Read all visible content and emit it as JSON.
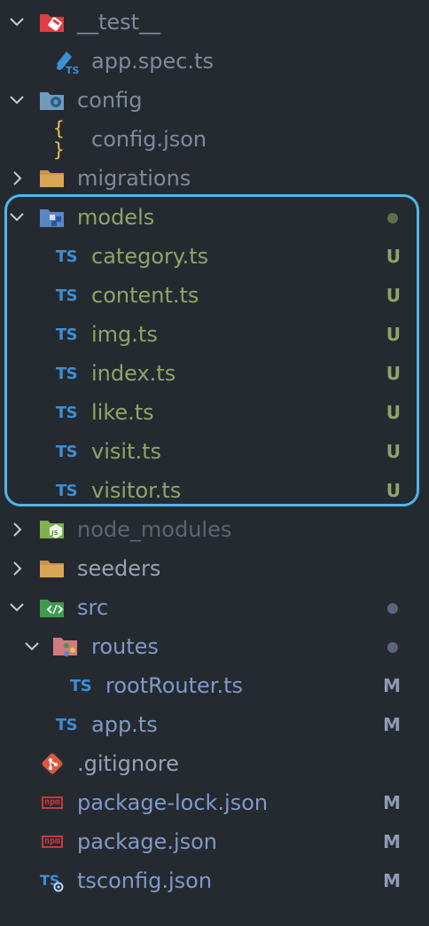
{
  "explorer": {
    "items": [
      {
        "label": "__test__",
        "icon": "test-folder-icon",
        "expanded": true
      },
      {
        "label": "app.spec.ts",
        "icon": "test-ts-file-icon"
      },
      {
        "label": "config",
        "icon": "config-folder-icon",
        "expanded": true
      },
      {
        "label": "config.json",
        "icon": "json-file-icon"
      },
      {
        "label": "migrations",
        "icon": "folder-icon",
        "expanded": false
      },
      {
        "label": "models",
        "icon": "models-folder-icon",
        "expanded": true,
        "status": "modified-dot"
      },
      {
        "label": "category.ts",
        "icon": "ts-file-icon",
        "badge": "U"
      },
      {
        "label": "content.ts",
        "icon": "ts-file-icon",
        "badge": "U"
      },
      {
        "label": "img.ts",
        "icon": "ts-file-icon",
        "badge": "U"
      },
      {
        "label": "index.ts",
        "icon": "ts-file-icon",
        "badge": "U"
      },
      {
        "label": "like.ts",
        "icon": "ts-file-icon",
        "badge": "U"
      },
      {
        "label": "visit.ts",
        "icon": "ts-file-icon",
        "badge": "U"
      },
      {
        "label": "visitor.ts",
        "icon": "ts-file-icon",
        "badge": "U"
      },
      {
        "label": "node_modules",
        "icon": "node-folder-icon",
        "expanded": false
      },
      {
        "label": "seeders",
        "icon": "folder-icon",
        "expanded": false
      },
      {
        "label": "src",
        "icon": "src-folder-icon",
        "expanded": true,
        "status": "modified-dot"
      },
      {
        "label": "routes",
        "icon": "routes-folder-icon",
        "expanded": true,
        "status": "modified-dot"
      },
      {
        "label": "rootRouter.ts",
        "icon": "ts-file-icon",
        "badge": "M"
      },
      {
        "label": "app.ts",
        "icon": "ts-file-icon",
        "badge": "M"
      },
      {
        "label": ".gitignore",
        "icon": "git-icon"
      },
      {
        "label": "package-lock.json",
        "icon": "npm-icon",
        "badge": "M"
      },
      {
        "label": "package.json",
        "icon": "npm-icon",
        "badge": "M"
      },
      {
        "label": "tsconfig.json",
        "icon": "tsconfig-icon",
        "badge": "M"
      }
    ]
  },
  "icons": {
    "ts_text": "TS",
    "ts_small": "TS",
    "json_text": "{ }",
    "npm_text": "npm",
    "js_text": "JS"
  },
  "colors": {
    "background": "#252a31",
    "untracked": "#8fa468",
    "modified": "#8f9bb3",
    "highlight_border": "#4db7e8",
    "ts_blue": "#3d8fd6"
  }
}
